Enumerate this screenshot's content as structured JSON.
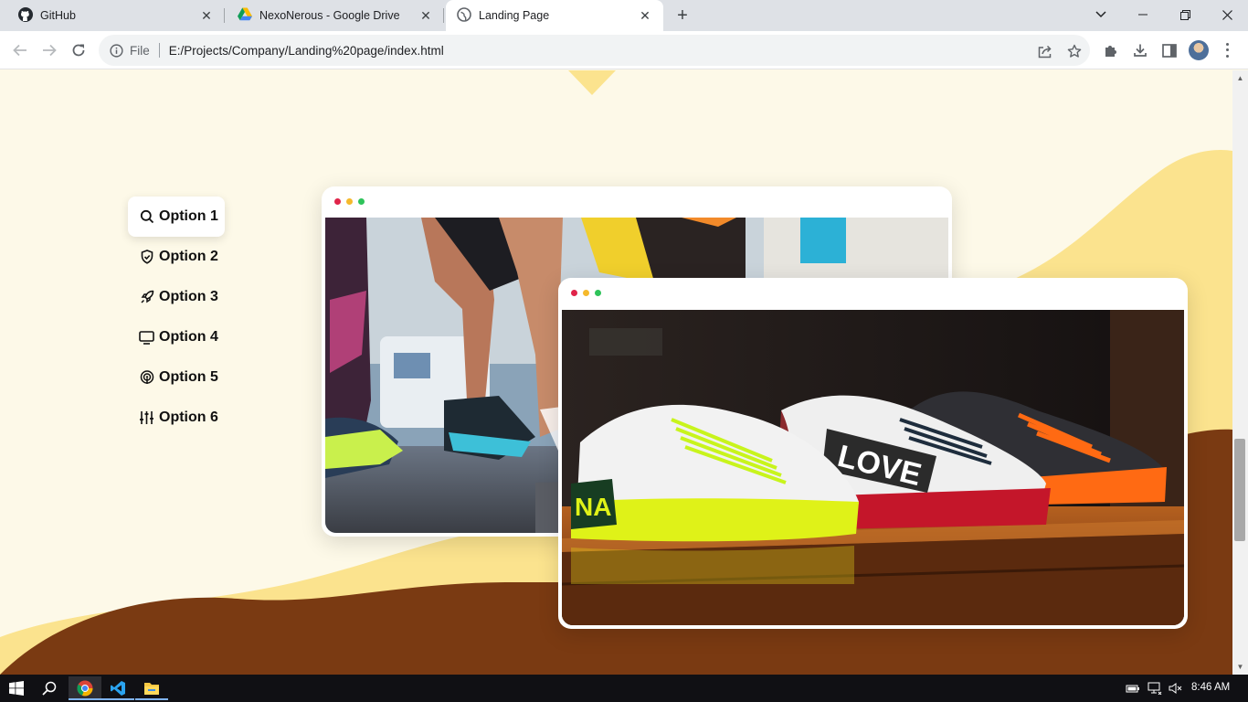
{
  "browser": {
    "tabs": [
      {
        "title": "GitHub",
        "icon": "github-icon",
        "active": false
      },
      {
        "title": "NexoNerous - Google Drive",
        "icon": "google-drive-icon",
        "active": false
      },
      {
        "title": "Landing Page",
        "icon": "globe-icon",
        "active": true
      }
    ],
    "omnibox": {
      "scheme_label": "File",
      "url": "E:/Projects/Company/Landing%20page/index.html"
    }
  },
  "page": {
    "colors": {
      "background": "#fdf9e8",
      "wave_light": "#fbe38e",
      "wave_dark": "#7a3a12",
      "dot_red": "#e0244a",
      "dot_yellow": "#f5b92c",
      "dot_green": "#2ec35a"
    },
    "menu": [
      {
        "label": "Option 1",
        "icon": "search-icon",
        "active": true
      },
      {
        "label": "Option 2",
        "icon": "shield-check-icon",
        "active": false
      },
      {
        "label": "Option 3",
        "icon": "rocket-icon",
        "active": false
      },
      {
        "label": "Option 4",
        "icon": "monitor-icon",
        "active": false
      },
      {
        "label": "Option 5",
        "icon": "broadcast-icon",
        "active": false
      },
      {
        "label": "Option 6",
        "icon": "sliders-icon",
        "active": false
      }
    ],
    "cards": [
      {
        "image": "runners-legs-photo"
      },
      {
        "image": "sneakers-on-shelf-photo"
      }
    ]
  },
  "taskbar": {
    "apps": [
      "start-icon",
      "search-icon",
      "chrome-icon",
      "vscode-icon",
      "file-explorer-icon"
    ],
    "clock": "8:46 AM"
  }
}
